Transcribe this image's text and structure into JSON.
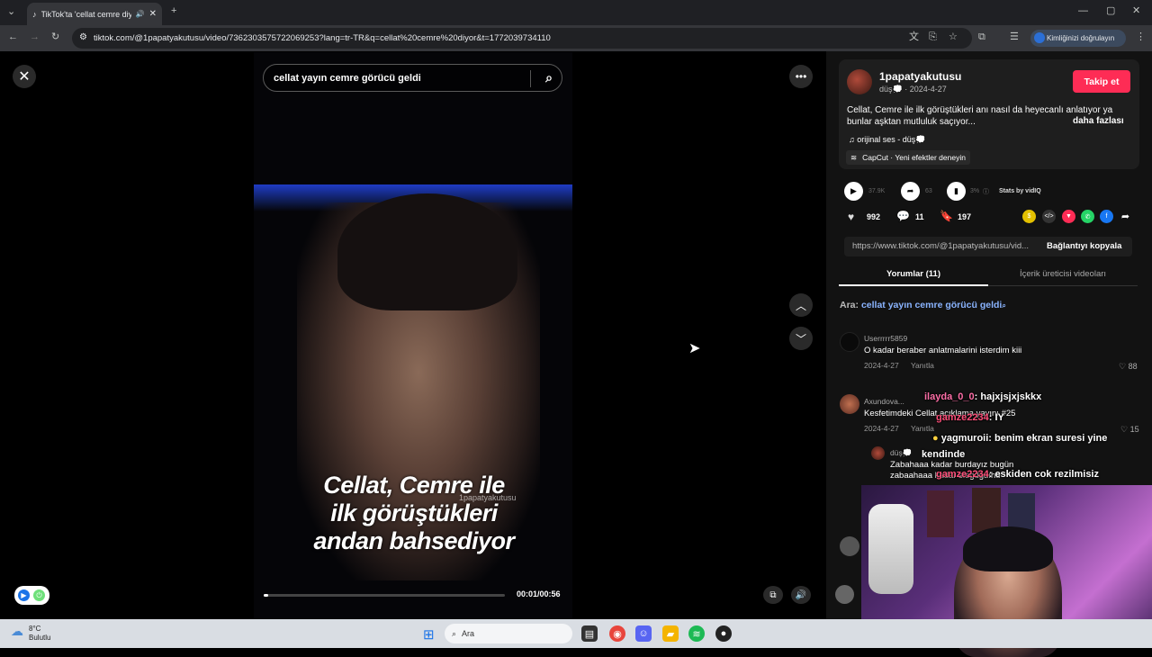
{
  "browser": {
    "tab_title": "TikTok'ta 'cellat cemre diyor'",
    "url": "tiktok.com/@1papatyakutusu/video/7362303575722069253?lang=tr-TR&q=cellat%20cemre%20diyor&t=1772039734110",
    "identity_label": "Kimliğinizi doğrulayın"
  },
  "video": {
    "search_value": "cellat yayın cemre görücü geldi",
    "caption_lines": [
      "Cellat, Cemre ile",
      "ilk görüştükleri",
      "andan bahsediyor"
    ],
    "watermark": "1papatyakutusu",
    "time": "00:01/00:56",
    "progress_fraction": 0.02
  },
  "post": {
    "username": "1papatyakutusu",
    "sub": "düş💭 · 2024-4-27",
    "follow_label": "Takip et",
    "description": "Cellat, Cemre ile ilk görüştükleri anı nasıl da heyecanlı anlatıyor ya bunlar aşktan mutluluk saçıyor...",
    "more_label": "daha fazlası",
    "music": "orijinal ses - düş💭",
    "capcut": "CapCut · Yeni efektler deneyin"
  },
  "stats": {
    "plays": "37.9K",
    "shares_small": "63",
    "ratio": "3%",
    "vidiq": "Stats by vidIQ",
    "likes": "992",
    "comments": "11",
    "saves": "197"
  },
  "link": {
    "url": "https://www.tiktok.com/@1papatyakutusu/vid...",
    "copy_label": "Bağlantıyı kopyala"
  },
  "tabs": {
    "comments": "Yorumlar (11)",
    "creator": "İçerik üreticisi videoları"
  },
  "related": {
    "prefix": "Ara:",
    "query": "cellat yayın cemre görücü geldi"
  },
  "comments": [
    {
      "user": "Userrrrr5859",
      "text": "O kadar beraber anlatmalarini isterdim kiii",
      "date": "2024-4-27",
      "reply": "Yanıtla",
      "likes": "88"
    },
    {
      "user": "Axundova...",
      "text": "Kesfetimdeki Cellat açıklama yayını #25",
      "date": "2024-4-27",
      "reply": "Yanıtla",
      "likes": "15"
    },
    {
      "user": "düş💭",
      "text": "Zabahaaa kadar burdayız bugün zabaahaaa kadar sfsgdgdıhd"
    }
  ],
  "chat": [
    {
      "name": "ilayda_0_0",
      "msg": ": hajxjsjxjskkx"
    },
    {
      "name": "gamze2234",
      "msg": ": IY"
    },
    {
      "name": "yagmuroii",
      "msg": ": benim ekran suresi yine"
    },
    {
      "name": "",
      "msg": "kendinde"
    },
    {
      "name": "gamze2234",
      "msg": ": eskiden cok rezilmisiz"
    }
  ],
  "taskbar": {
    "temp": "8°C",
    "weather": "Bulutlu",
    "search": "Ara"
  },
  "colors": {
    "accent": "#fe2c55",
    "panel": "#121212",
    "link_blue": "#8ab4ff"
  }
}
